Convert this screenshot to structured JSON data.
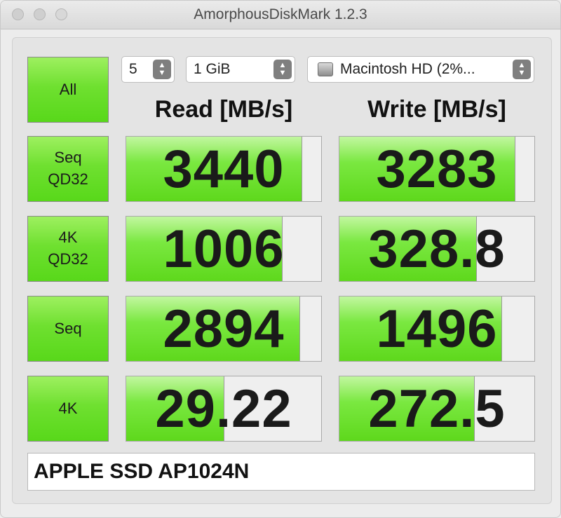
{
  "window": {
    "title": "AmorphousDiskMark 1.2.3"
  },
  "controls": {
    "all_label": "All",
    "count": "5",
    "size": "1 GiB",
    "drive": "Macintosh HD (2%..."
  },
  "headers": {
    "read": "Read [MB/s]",
    "write": "Write [MB/s]"
  },
  "rows": [
    {
      "label": "Seq\nQD32",
      "read": "3440",
      "write": "3283",
      "read_fill_pct": 90,
      "write_fill_pct": 90
    },
    {
      "label": "4K\nQD32",
      "read": "1006",
      "write": "328.8",
      "read_fill_pct": 80,
      "write_fill_pct": 70
    },
    {
      "label": "Seq",
      "read": "2894",
      "write": "1496",
      "read_fill_pct": 89,
      "write_fill_pct": 83
    },
    {
      "label": "4K",
      "read": "29.22",
      "write": "272.5",
      "read_fill_pct": 50,
      "write_fill_pct": 69
    }
  ],
  "device": {
    "model": "APPLE SSD AP1024N"
  }
}
